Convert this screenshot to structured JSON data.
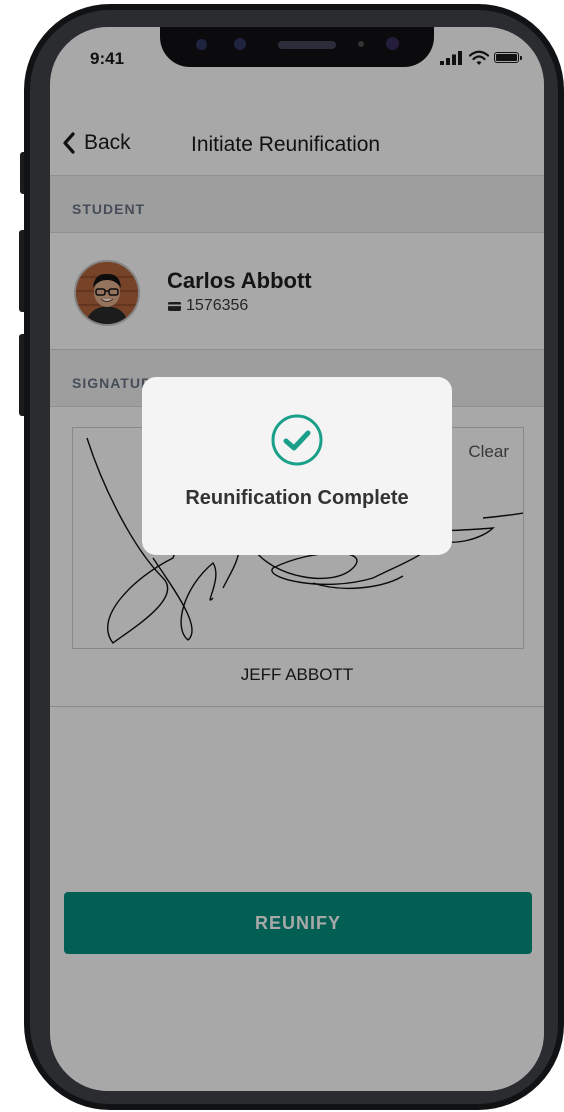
{
  "status_bar": {
    "time": "9:41"
  },
  "nav": {
    "back_label": "Back",
    "title": "Initiate Reunification"
  },
  "student_section": {
    "header": "STUDENT",
    "student": {
      "name": "Carlos Abbott",
      "id": "1576356"
    }
  },
  "signature_section": {
    "header": "SIGNATURE",
    "clear_label": "Clear",
    "signer_name": "JEFF ABBOTT"
  },
  "actions": {
    "reunify_label": "REUNIFY"
  },
  "toast": {
    "message": "Reunification Complete"
  },
  "colors": {
    "accent_teal": "#05907f",
    "check_green": "#1aa08a",
    "overlay": "rgba(0,0,0,0.34)"
  },
  "icons": [
    "back-chevron-icon",
    "signal-icon",
    "wifi-icon",
    "battery-icon",
    "id-card-icon",
    "check-circle-icon"
  ]
}
